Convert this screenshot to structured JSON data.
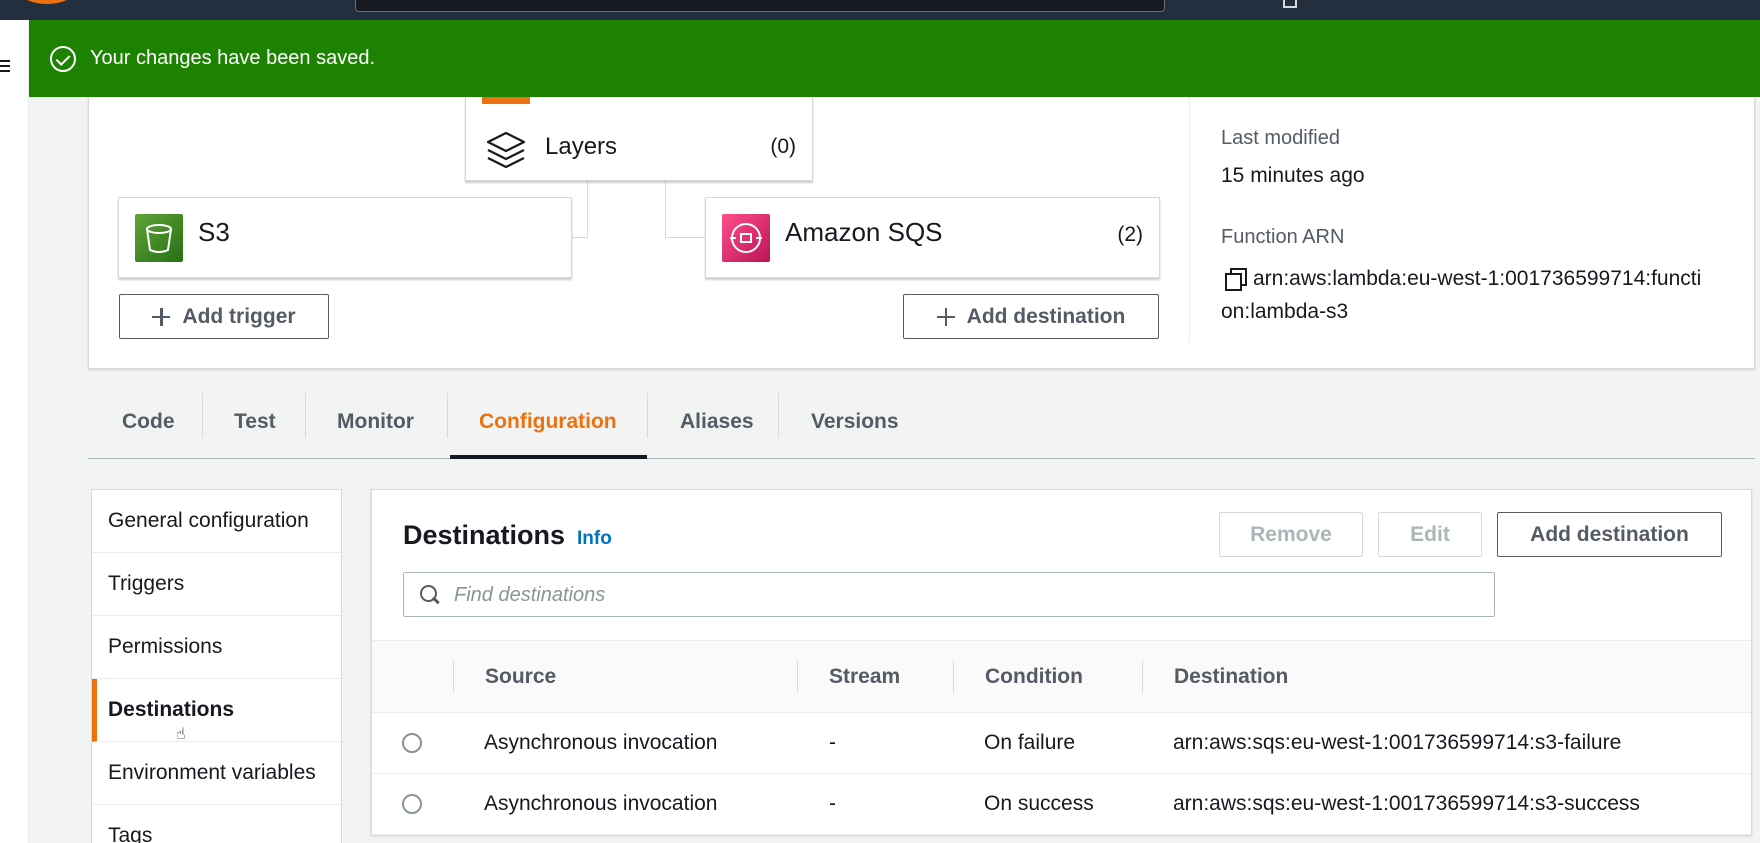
{
  "flash": {
    "message": "Your changes have been saved."
  },
  "diagram": {
    "layers": {
      "label": "Layers",
      "count": "(0)"
    },
    "trigger": {
      "name": "S3"
    },
    "destination": {
      "name": "Amazon SQS",
      "count": "(2)"
    },
    "add_trigger_label": "Add trigger",
    "add_destination_label": "Add destination"
  },
  "meta": {
    "last_modified_label": "Last modified",
    "last_modified_value": "15 minutes ago",
    "function_arn_label": "Function ARN",
    "function_arn_line1": "arn:aws:lambda:eu-west-1:001736599714:functi",
    "function_arn_line2": "on:lambda-s3"
  },
  "tabs": [
    "Code",
    "Test",
    "Monitor",
    "Configuration",
    "Aliases",
    "Versions"
  ],
  "active_tab": "Configuration",
  "config_nav": [
    "General configuration",
    "Triggers",
    "Permissions",
    "Destinations",
    "Environment variables",
    "Tags"
  ],
  "active_config": "Destinations",
  "destinations": {
    "title": "Destinations",
    "info": "Info",
    "remove_label": "Remove",
    "edit_label": "Edit",
    "add_label": "Add destination",
    "search_placeholder": "Find destinations",
    "columns": [
      "Source",
      "Stream",
      "Condition",
      "Destination"
    ],
    "rows": [
      {
        "source": "Asynchronous invocation",
        "stream": "-",
        "condition": "On failure",
        "destination": "arn:aws:sqs:eu-west-1:001736599714:s3-failure"
      },
      {
        "source": "Asynchronous invocation",
        "stream": "-",
        "condition": "On success",
        "destination": "arn:aws:sqs:eu-west-1:001736599714:s3-success"
      }
    ]
  },
  "colors": {
    "success": "#1d8102",
    "accent": "#ec7211",
    "link": "#0073bb",
    "header": "#232f3e"
  }
}
